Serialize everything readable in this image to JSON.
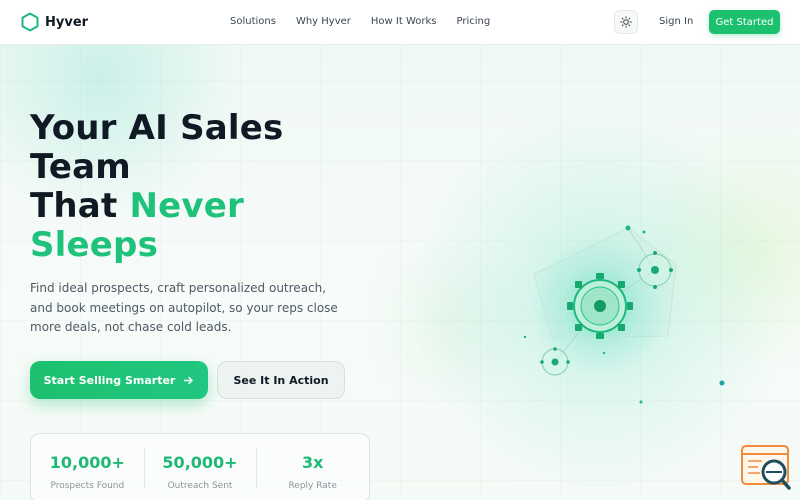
{
  "brand": {
    "name": "Hyver",
    "accent": "#1bc16f"
  },
  "nav": {
    "links": [
      "Solutions",
      "Why Hyver",
      "How It Works",
      "Pricing"
    ],
    "theme_icon": "sun-icon",
    "signin": "Sign In",
    "cta": "Get Started"
  },
  "hero": {
    "title_line1": "Your AI Sales",
    "title_line2": "Team",
    "title_line3_a": "That ",
    "title_line3_b": "Never",
    "title_line4": "Sleeps",
    "subtitle": "Find ideal prospects, craft personalized outreach, and book meetings on autopilot, so your reps close more deals, not chase cold leads.",
    "primary_button": "Start Selling Smarter",
    "primary_icon": "arrow-right-icon",
    "secondary_button": "See It In Action"
  },
  "stats": [
    {
      "value": "10,000+",
      "label": "Prospects Found"
    },
    {
      "value": "50,000+",
      "label": "Outreach Sent"
    },
    {
      "value": "3x",
      "label": "Reply Rate"
    }
  ]
}
